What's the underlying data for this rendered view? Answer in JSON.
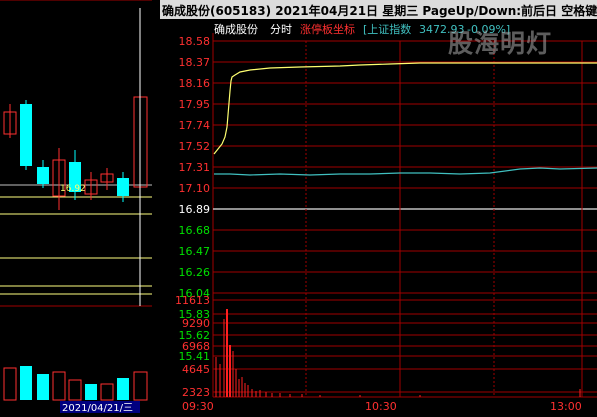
{
  "title_bar": {
    "text": "确成股份(605183)  2021年04月21日  星期三  PageUp/Down:前后日  空格键:操作"
  },
  "chart_header": {
    "stock_name": "确成股份",
    "mode": "分时",
    "limit_up_label": "涨停板坐标",
    "index_label": "[上证指数",
    "index_value": "3472.93",
    "index_change": "-0.09%]"
  },
  "watermark": "股海明灯",
  "price_axis": {
    "labels": [
      "18.58",
      "18.37",
      "18.16",
      "17.95",
      "17.74",
      "17.52",
      "17.31",
      "17.10",
      "16.89",
      "16.68",
      "16.47",
      "16.26",
      "16.04",
      "15.83",
      "15.62",
      "15.41"
    ],
    "reference_price": "16.89"
  },
  "volume_axis": {
    "labels": [
      "11613",
      "9290",
      "6968",
      "4645",
      "2323"
    ]
  },
  "time_axis": {
    "labels": [
      "09:30",
      "10:30",
      "13:00"
    ]
  },
  "left_panel": {
    "date_label": "2021/04/21/三",
    "cursor_price": "16.92"
  },
  "colors": {
    "background": "#000000",
    "grid_red": "#a00000",
    "price_up": "#ff3030",
    "price_down": "#ff3030",
    "price_line": "#ffff70",
    "avg_line": "#40c0c0",
    "volume": "#ff2020",
    "date_box_bg": "#000080",
    "candle_up": "#ff3030",
    "candle_down": "#00ffff"
  }
}
